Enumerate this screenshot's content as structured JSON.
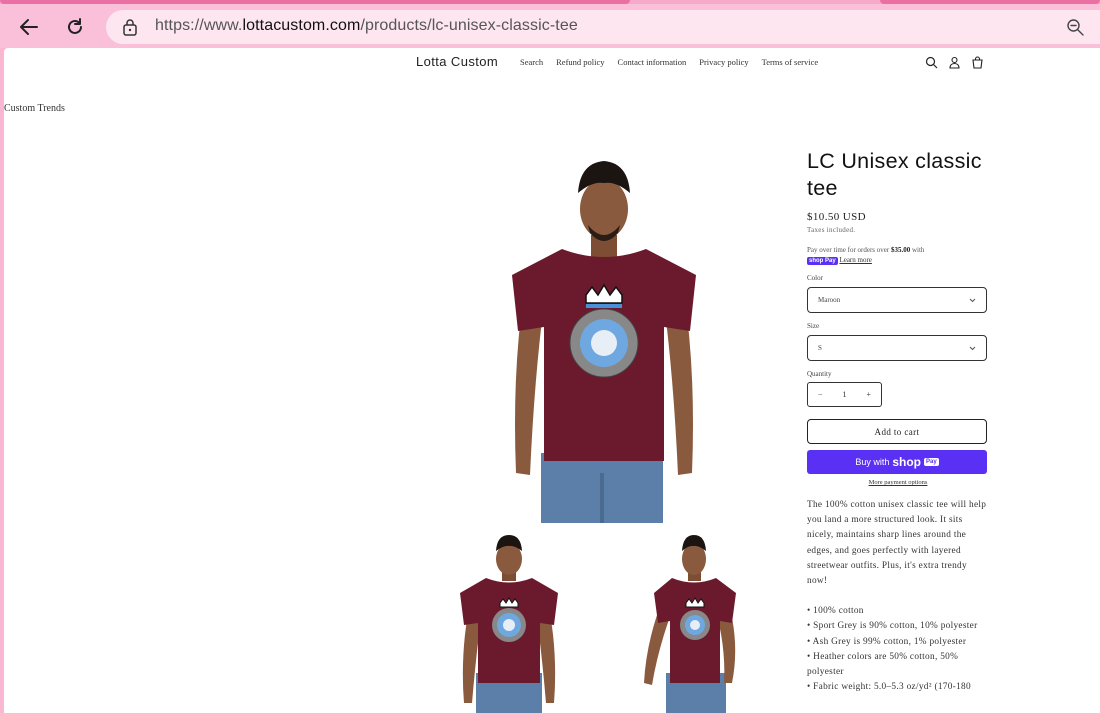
{
  "browser": {
    "url_prefix": "https://www.",
    "url_host": "lottacustom.com",
    "url_path": "/products/lc-unisex-classic-tee"
  },
  "header": {
    "brand": "Lotta Custom",
    "menu": [
      "Search",
      "Refund policy",
      "Contact information",
      "Privacy policy",
      "Terms of service"
    ]
  },
  "breadcrumb": "Custom Trends",
  "product": {
    "title": "LC Unisex classic tee",
    "price": "$10.50 USD",
    "tax_note": "Taxes included.",
    "shoppay_prefix": "Pay over time for orders over ",
    "shoppay_amount": "$35.00",
    "shoppay_suffix": " with",
    "shoppay_logo": "shop Pay",
    "learn_more": "Learn more",
    "color_label": "Color",
    "color_value": "Maroon",
    "size_label": "Size",
    "size_value": "S",
    "quantity_label": "Quantity",
    "quantity_value": "1",
    "qty_minus": "−",
    "qty_plus": "+",
    "add_to_cart": "Add to cart",
    "buy_with": "Buy with",
    "buy_shop": "shop",
    "buy_pay": "Pay",
    "more_payment": "More payment options",
    "description": "The 100% cotton unisex classic tee will help you land a more structured look. It sits nicely, maintains sharp lines around the edges, and goes perfectly with layered streetwear outfits. Plus, it's extra trendy now!",
    "features": [
      "• 100% cotton",
      "• Sport Grey is 90% cotton, 10% polyester",
      "• Ash Grey is 99% cotton, 1% polyester",
      "• Heather colors are 50% cotton, 50% polyester",
      "• Fabric weight: 5.0–5.3 oz/yd² (170-180"
    ]
  },
  "colors": {
    "shirt": "#6b1a2e",
    "shoppay": "#5a31f4",
    "chrome": "#fbc0d9"
  }
}
